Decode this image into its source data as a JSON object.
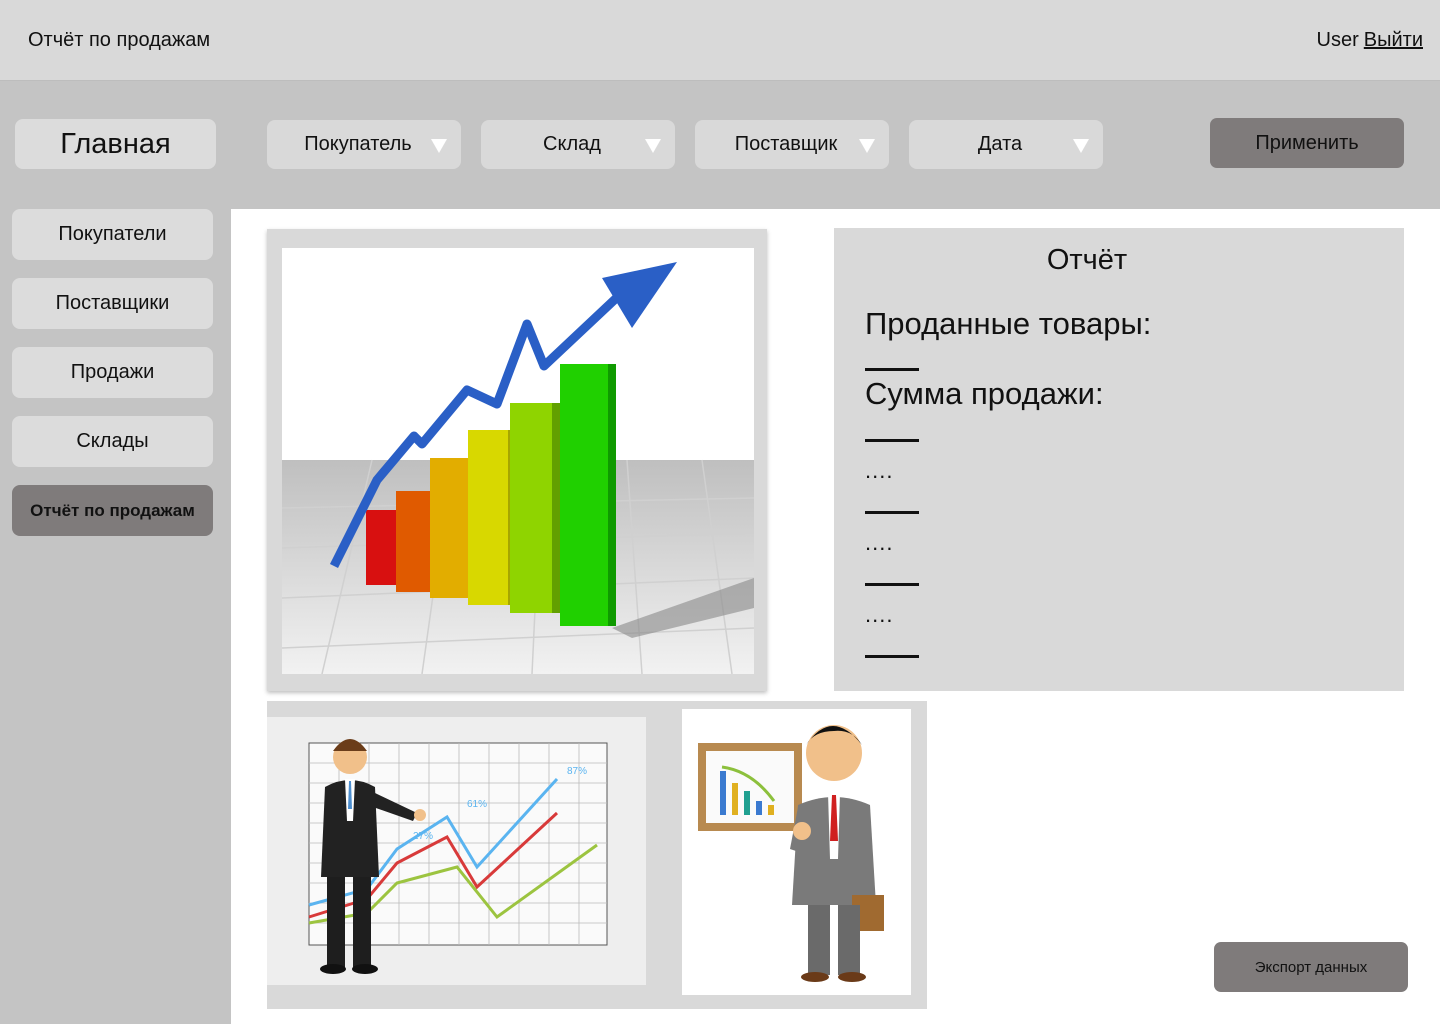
{
  "header": {
    "app_title": "Отчёт по продажам",
    "user_name": "User",
    "logout_label": "Выйти"
  },
  "toolbar": {
    "home_label": "Главная",
    "filters": [
      "Покупатель",
      "Склад",
      "Поставщик",
      "Дата"
    ],
    "apply_label": "Применить"
  },
  "sidebar": {
    "items": [
      {
        "label": "Покупатели"
      },
      {
        "label": "Поставщики"
      },
      {
        "label": "Продажи"
      },
      {
        "label": "Склады"
      },
      {
        "label": "Отчёт по продажам",
        "active": true
      }
    ]
  },
  "report": {
    "title": "Отчёт",
    "sold_label": "Проданные товары:",
    "sum_label": "Сумма продажи:",
    "dots": "...."
  },
  "pics": {
    "chart_labels": [
      "27%",
      "61%",
      "87%"
    ]
  },
  "export_label": "Экспорт данных",
  "icons": {
    "filter_caret": "chevron-down-icon"
  }
}
